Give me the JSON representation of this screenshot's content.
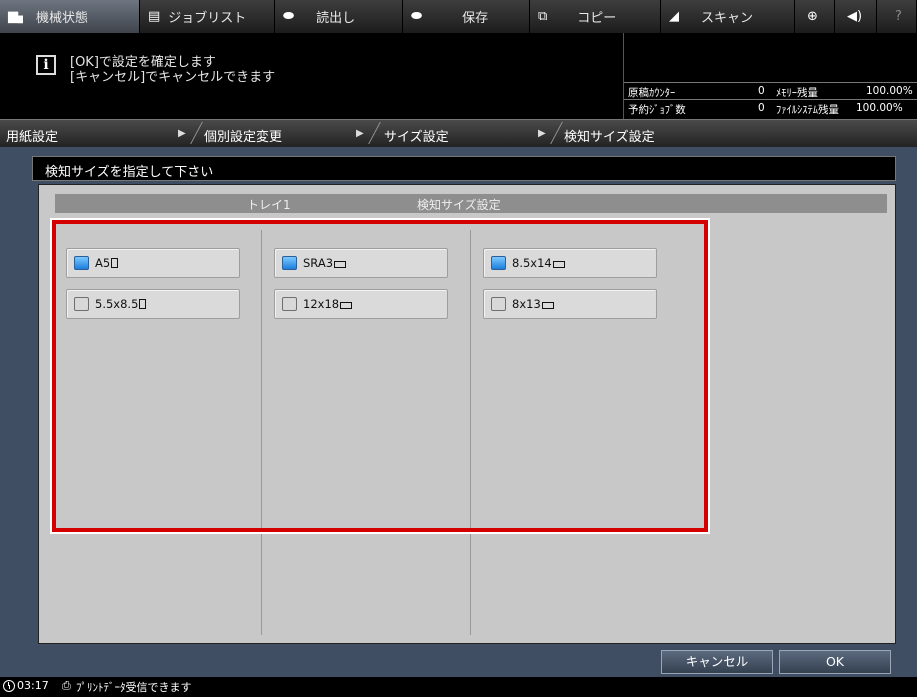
{
  "top_tabs": [
    {
      "icon": "machine-status-icon",
      "glyph": "▆▖",
      "label": "機械状態"
    },
    {
      "icon": "job-list-icon",
      "glyph": "▤",
      "label": "ジョブリスト"
    },
    {
      "icon": "recall-icon",
      "glyph": "⬬",
      "label": "読出し"
    },
    {
      "icon": "save-icon",
      "glyph": "⬬",
      "label": "保存"
    },
    {
      "icon": "copy-icon",
      "glyph": "⧉",
      "label": "コピー"
    },
    {
      "icon": "scan-icon",
      "glyph": "◢",
      "label": "スキャン"
    },
    {
      "icon": "globe-icon",
      "glyph": "⊕",
      "label": ""
    },
    {
      "icon": "volume-icon",
      "glyph": "◀)",
      "label": ""
    },
    {
      "icon": "help-icon",
      "glyph": "?",
      "label": ""
    }
  ],
  "message": {
    "info_icon": "i",
    "line1": "[OK]で設定を確定します",
    "line2": "[キャンセル]でキャンセルできます"
  },
  "counters": {
    "original_counter_label": "原稿ｶｳﾝﾀｰ",
    "original_counter_value": "0",
    "memory_label": "ﾒﾓﾘｰ残量",
    "memory_value": "100.00%",
    "reserved_jobs_label": "予約ｼﾞｮﾌﾞ数",
    "reserved_jobs_value": "0",
    "filesystem_label": "ﾌｧｲﾙｼｽﾃﾑ残量",
    "filesystem_value": "100.00%"
  },
  "breadcrumb": [
    "用紙設定",
    "個別設定変更",
    "サイズ設定",
    "検知サイズ設定"
  ],
  "instruction": "検知サイズを指定して下さい",
  "columns": {
    "tray": "トレイ1",
    "detect_size": "検知サイズ設定"
  },
  "sizes": [
    {
      "label": "A5",
      "checked": true,
      "orientation": "portrait"
    },
    {
      "label": "5.5x8.5",
      "checked": false,
      "orientation": "portrait"
    },
    {
      "label": "SRA3",
      "checked": true,
      "orientation": "landscape"
    },
    {
      "label": "12x18",
      "checked": false,
      "orientation": "landscape"
    },
    {
      "label": "8.5x14",
      "checked": true,
      "orientation": "landscape"
    },
    {
      "label": "8x13",
      "checked": false,
      "orientation": "landscape"
    }
  ],
  "buttons": {
    "cancel": "キャンセル",
    "ok": "OK"
  },
  "status": {
    "time": "03:17",
    "message": "ﾌﾟﾘﾝﾄﾃﾞｰﾀ受信できます"
  }
}
